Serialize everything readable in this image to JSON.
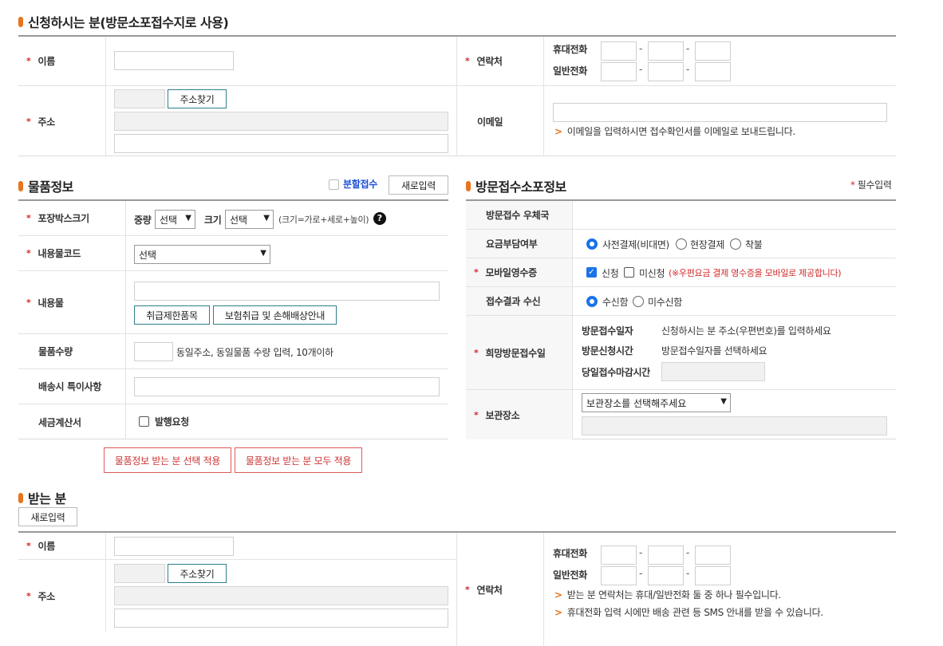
{
  "applicant": {
    "title": "신청하시는 분(방문소포접수지로 사용)",
    "name_label": "이름",
    "address_label": "주소",
    "address_btn": "주소찾기",
    "contact_label": "연락처",
    "mobile_label": "휴대전화",
    "phone_label": "일반전화",
    "email_label": "이메일",
    "email_hint": "이메일을 입력하시면 접수확인서를 이메일로 보내드립니다."
  },
  "item": {
    "title": "물품정보",
    "split_label": "분할접수",
    "new_btn": "새로입력",
    "box_label": "포장박스크기",
    "weight_label": "중량",
    "weight_value": "선택",
    "size_label": "크기",
    "size_value": "선택",
    "size_hint": "(크기=가로+세로+높이)",
    "help_icon": "?",
    "code_label": "내용물코드",
    "code_value": "선택",
    "content_label": "내용물",
    "restrict_btn": "취급제한품목",
    "insure_btn": "보험취급 및 손해배상안내",
    "qty_label": "물품수량",
    "qty_hint": "동일주소, 동일물품 수량 입력, 10개이하",
    "note_label": "배송시 특이사항",
    "tax_label": "세금계산서",
    "tax_option": "발행요청",
    "apply_select_btn": "물품정보 받는 분 선택 적용",
    "apply_all_btn": "물품정보 받는 분 모두 적용"
  },
  "visit": {
    "title": "방문접수소포정보",
    "required_note": "필수입력",
    "office_label": "방문접수 우체국",
    "fee_label": "요금부담여부",
    "fee_options": [
      "사전결제(비대면)",
      "현장결제",
      "착불"
    ],
    "receipt_label": "모바일영수증",
    "receipt_options": [
      "신청",
      "미신청"
    ],
    "receipt_note": "(※우편요금 결제 영수증을 모바일로 제공합니다)",
    "result_label": "접수결과 수신",
    "result_options": [
      "수신함",
      "미수신함"
    ],
    "date_label": "희망방문접수일",
    "date_k1": "방문접수일자",
    "date_v1": "신청하시는 분 주소(우편번호)를 입력하세요",
    "date_k2": "방문신청시간",
    "date_v2": "방문접수일자를 선택하세요",
    "date_k3": "당일접수마감시간",
    "storage_label": "보관장소",
    "storage_value": "보관장소를 선택해주세요"
  },
  "receiver": {
    "title": "받는 분",
    "new_btn": "새로입력",
    "name_label": "이름",
    "address_label": "주소",
    "address_btn": "주소찾기",
    "contact_label": "연락처",
    "mobile_label": "휴대전화",
    "phone_label": "일반전화",
    "hint1": "받는 분 연락처는 휴대/일반전화 둘 중 하나 필수입니다.",
    "hint2": "휴대전화 입력 시에만 배송 관련 등 SMS 안내를 받을 수 있습니다."
  },
  "common": {
    "req_mark": "*",
    "dash": "-",
    "hint_mark": ">"
  },
  "colors": {
    "accent": "#e8741e",
    "required": "#d12a2a",
    "radio": "#1a73e8",
    "button_border": "#2f7f8a"
  }
}
